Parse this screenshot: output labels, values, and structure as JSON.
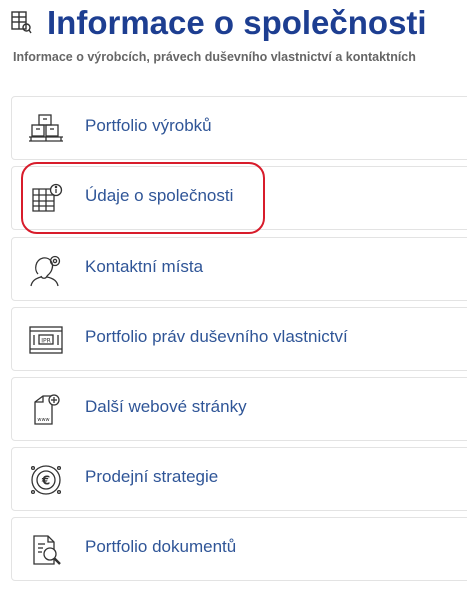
{
  "header": {
    "icon": "company-register-icon",
    "title": "Informace o společnosti",
    "subtitle": "Informace o výrobcích, právech duševního vlastnictví a kontaktních"
  },
  "menu": {
    "items": [
      {
        "label": "Portfolio výrobků",
        "icon": "pallet-boxes-icon"
      },
      {
        "label": "Údaje o společnosti",
        "icon": "building-info-icon",
        "highlighted": true
      },
      {
        "label": "Kontaktní místa",
        "icon": "person-location-icon"
      },
      {
        "label": "Portfolio práv duševního vlastnictví",
        "icon": "ipr-certificate-icon"
      },
      {
        "label": "Další webové stránky",
        "icon": "web-page-add-icon"
      },
      {
        "label": "Prodejní strategie",
        "icon": "euro-target-icon"
      },
      {
        "label": "Portfolio dokumentů",
        "icon": "document-search-icon"
      }
    ]
  },
  "colors": {
    "title": "#1d3e91",
    "link": "#2f5597",
    "highlight": "#d81c2b",
    "border": "#e3e3e3"
  }
}
